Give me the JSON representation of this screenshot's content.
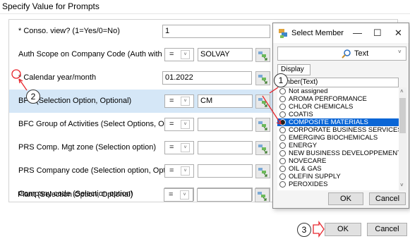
{
  "page": {
    "title": "Specify Value for Prompts"
  },
  "prompts": [
    {
      "label": "* Conso. view? (1=Yes/0=No)",
      "value": "1"
    },
    {
      "label": "Auth Scope on Company Code (Auth with input)",
      "operator": "=",
      "value": "SOLVAY"
    },
    {
      "label": "* Calendar year/month",
      "value": "01.2022"
    },
    {
      "label": "BFC    (Selection Option, Optional)",
      "operator": "=",
      "value": "CM"
    },
    {
      "label": "BFC Group of Activities (Select Options, Optional)",
      "operator": "=",
      "value": ""
    },
    {
      "label": "PRS Comp. Mgt zone (Selection option)",
      "operator": "=",
      "value": ""
    },
    {
      "label": "PRS Company code (Selection option, Optional)",
      "operator": "=",
      "value": ""
    },
    {
      "label": "Company code (Selection option)",
      "operator": "=",
      "value": ""
    },
    {
      "label": "Plant (Selection Option, Optional)",
      "operator": "=",
      "value": ""
    }
  ],
  "dialog": {
    "title": "Select Member",
    "search_mode": "Text",
    "display_button": "Display",
    "column_header": "ember(Text)",
    "members": [
      "Not assigned",
      "AROMA PERFORMANCE",
      "CHLOR CHEMICALS",
      "COATIS",
      "COMPOSITE MATERIALS",
      "CORPORATE BUSINESS SERVICES",
      "EMERGING BIOCHEMICALS",
      "ENERGY",
      "NEW BUSINESS DEVELOPPEMENT",
      "NOVECARE",
      "OIL & GAS",
      "OLEFIN SUPPLY",
      "PEROXIDES"
    ],
    "selected_member": "COMPOSITE MATERIALS",
    "ok_label": "OK",
    "cancel_label": "Cancel"
  },
  "footer": {
    "ok_label": "OK",
    "cancel_label": "Cancel"
  },
  "callouts": [
    "1",
    "2",
    "3"
  ],
  "colors": {
    "selected_row": "#d5e7f7",
    "selected_member": "#0a66d6",
    "annotation": "#e8242b"
  }
}
